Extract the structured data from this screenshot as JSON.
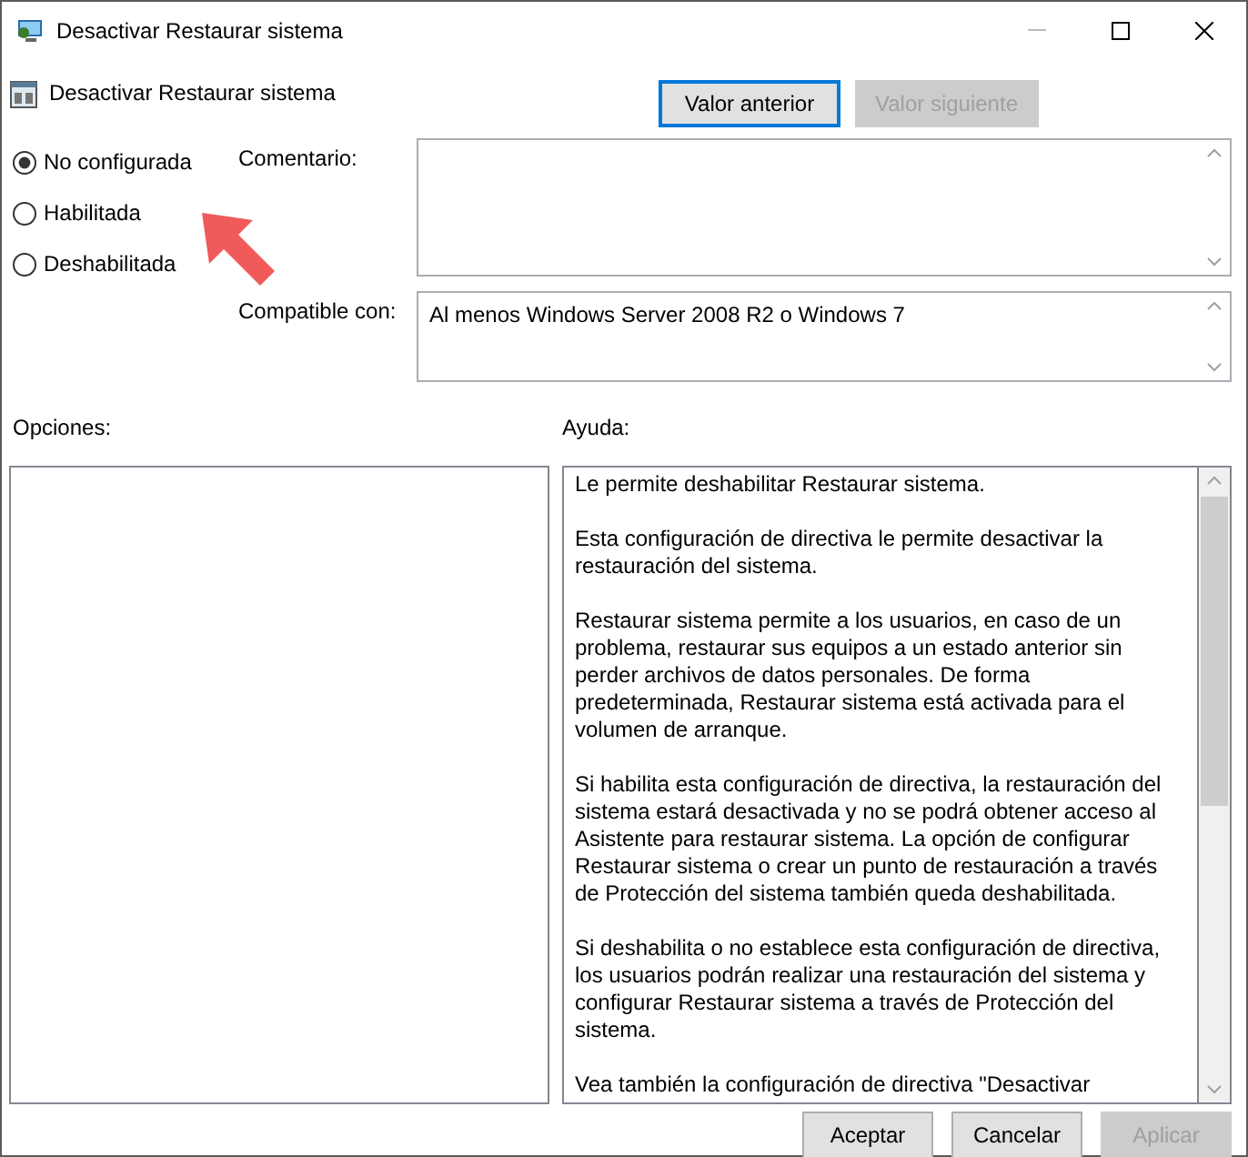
{
  "window": {
    "title": "Desactivar Restaurar sistema"
  },
  "header": {
    "policy_name": "Desactivar Restaurar sistema",
    "buttons": [
      {
        "label": "Valor anterior",
        "disabled": false,
        "focused": true
      },
      {
        "label": "Valor siguiente",
        "disabled": true,
        "focused": false
      }
    ]
  },
  "state_options": [
    {
      "label": "No configurada",
      "selected": true
    },
    {
      "label": "Habilitada",
      "selected": false
    },
    {
      "label": "Deshabilitada",
      "selected": false
    }
  ],
  "comment": {
    "label": "Comentario:"
  },
  "supported_on": {
    "label": "Compatible con:",
    "value": "Al menos Windows Server 2008 R2 o Windows 7"
  },
  "options": {
    "label": "Opciones:"
  },
  "help": {
    "label": "Ayuda:",
    "paragraphs": [
      "Le permite deshabilitar Restaurar sistema.",
      "Esta configuración de directiva le permite desactivar la restauración del sistema.",
      "Restaurar sistema permite a los usuarios, en caso de un problema, restaurar sus equipos a un estado anterior sin perder archivos de datos personales. De forma predeterminada, Restaurar sistema está activada para el volumen de arranque.",
      "Si habilita esta configuración de directiva, la restauración del sistema estará desactivada y no se podrá obtener acceso al Asistente para restaurar sistema. La opción de configurar Restaurar sistema o crear un punto de restauración a través de Protección del sistema también queda deshabilitada.",
      "Si deshabilita o no establece esta configuración de directiva, los usuarios podrán realizar una restauración del sistema y configurar Restaurar sistema a través de Protección del sistema.",
      "Vea también la configuración de directiva \"Desactivar"
    ]
  },
  "footer_buttons": [
    {
      "label": "Aceptar",
      "disabled": false
    },
    {
      "label": "Cancelar",
      "disabled": false
    },
    {
      "label": "Aplicar",
      "disabled": true
    }
  ]
}
